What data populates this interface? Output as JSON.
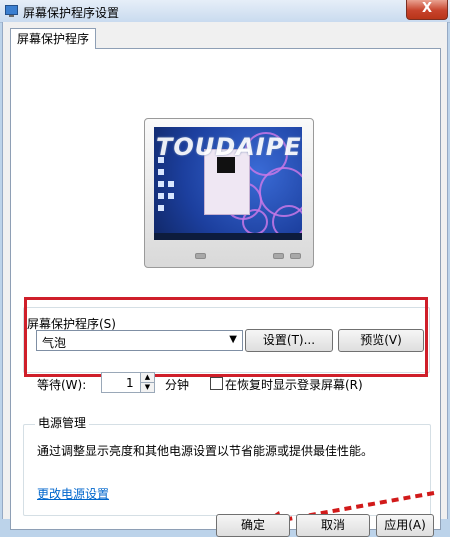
{
  "window": {
    "title": "屏幕保护程序设置",
    "close_glyph": "X"
  },
  "tab": {
    "label": "屏幕保护程序"
  },
  "preview": {
    "watermark": "TOUDAIPE.Z"
  },
  "screensaver": {
    "group_label": "屏幕保护程序(S)",
    "selected": "气泡",
    "settings_label": "设置(T)...",
    "preview_label": "预览(V)"
  },
  "wait": {
    "label": "等待(W):",
    "value": "1",
    "unit": "分钟",
    "resume_label": "在恢复时显示登录屏幕(R)",
    "resume_checked": false
  },
  "power": {
    "title": "电源管理",
    "description": "通过调整显示亮度和其他电源设置以节省能源或提供最佳性能。",
    "link": "更改电源设置"
  },
  "footer": {
    "ok_label": "确定",
    "cancel_label": "取消",
    "apply_label": "应用(A)"
  },
  "colors": {
    "highlight_box": "#cf1f2a",
    "link": "#0066cc"
  },
  "icons": [
    "app-icon",
    "close-icon",
    "chevron-down-icon",
    "spin-up-icon",
    "spin-down-icon",
    "arrow-annotation-icon"
  ]
}
